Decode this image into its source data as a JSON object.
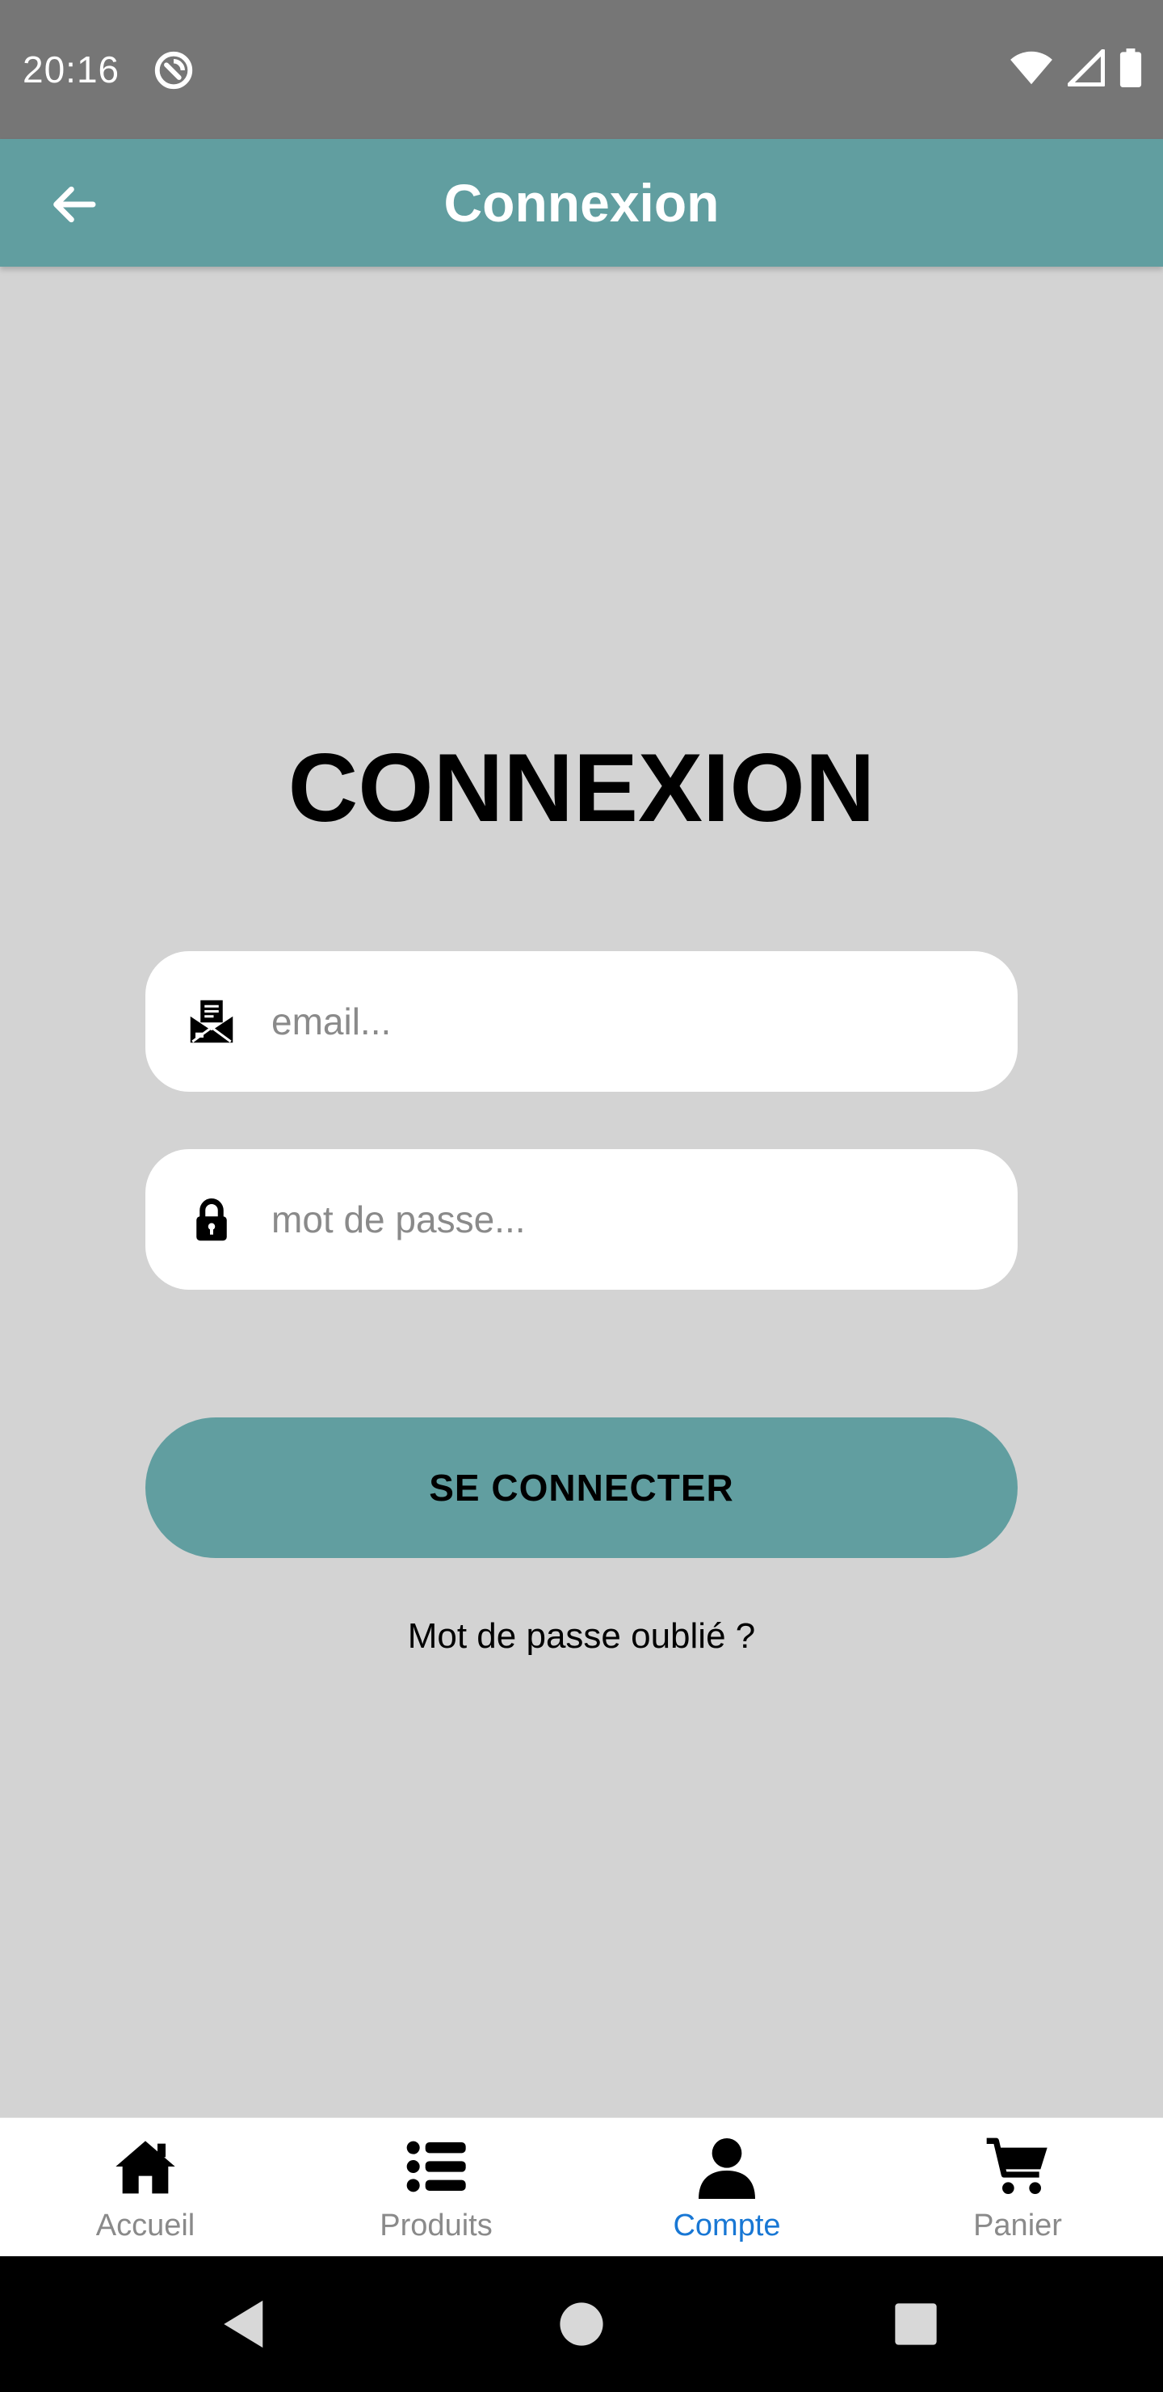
{
  "status_bar": {
    "time": "20:16"
  },
  "app_bar": {
    "title": "Connexion"
  },
  "login": {
    "heading": "CONNEXION",
    "email_placeholder": "email...",
    "email_value": "",
    "password_placeholder": "mot de passe...",
    "password_value": "",
    "submit_label": "SE CONNECTER",
    "forgot_label": "Mot de passe oublié ?"
  },
  "bottom_nav": {
    "items": [
      {
        "label": "Accueil",
        "icon": "home-icon",
        "active": false
      },
      {
        "label": "Produits",
        "icon": "list-icon",
        "active": false
      },
      {
        "label": "Compte",
        "icon": "person-icon",
        "active": true
      },
      {
        "label": "Panier",
        "icon": "cart-icon",
        "active": false
      }
    ]
  },
  "colors": {
    "accent": "#619ea0",
    "background": "#d3d3d3",
    "active_tab": "#1877d4",
    "inactive_tab": "#8a8a8a"
  }
}
